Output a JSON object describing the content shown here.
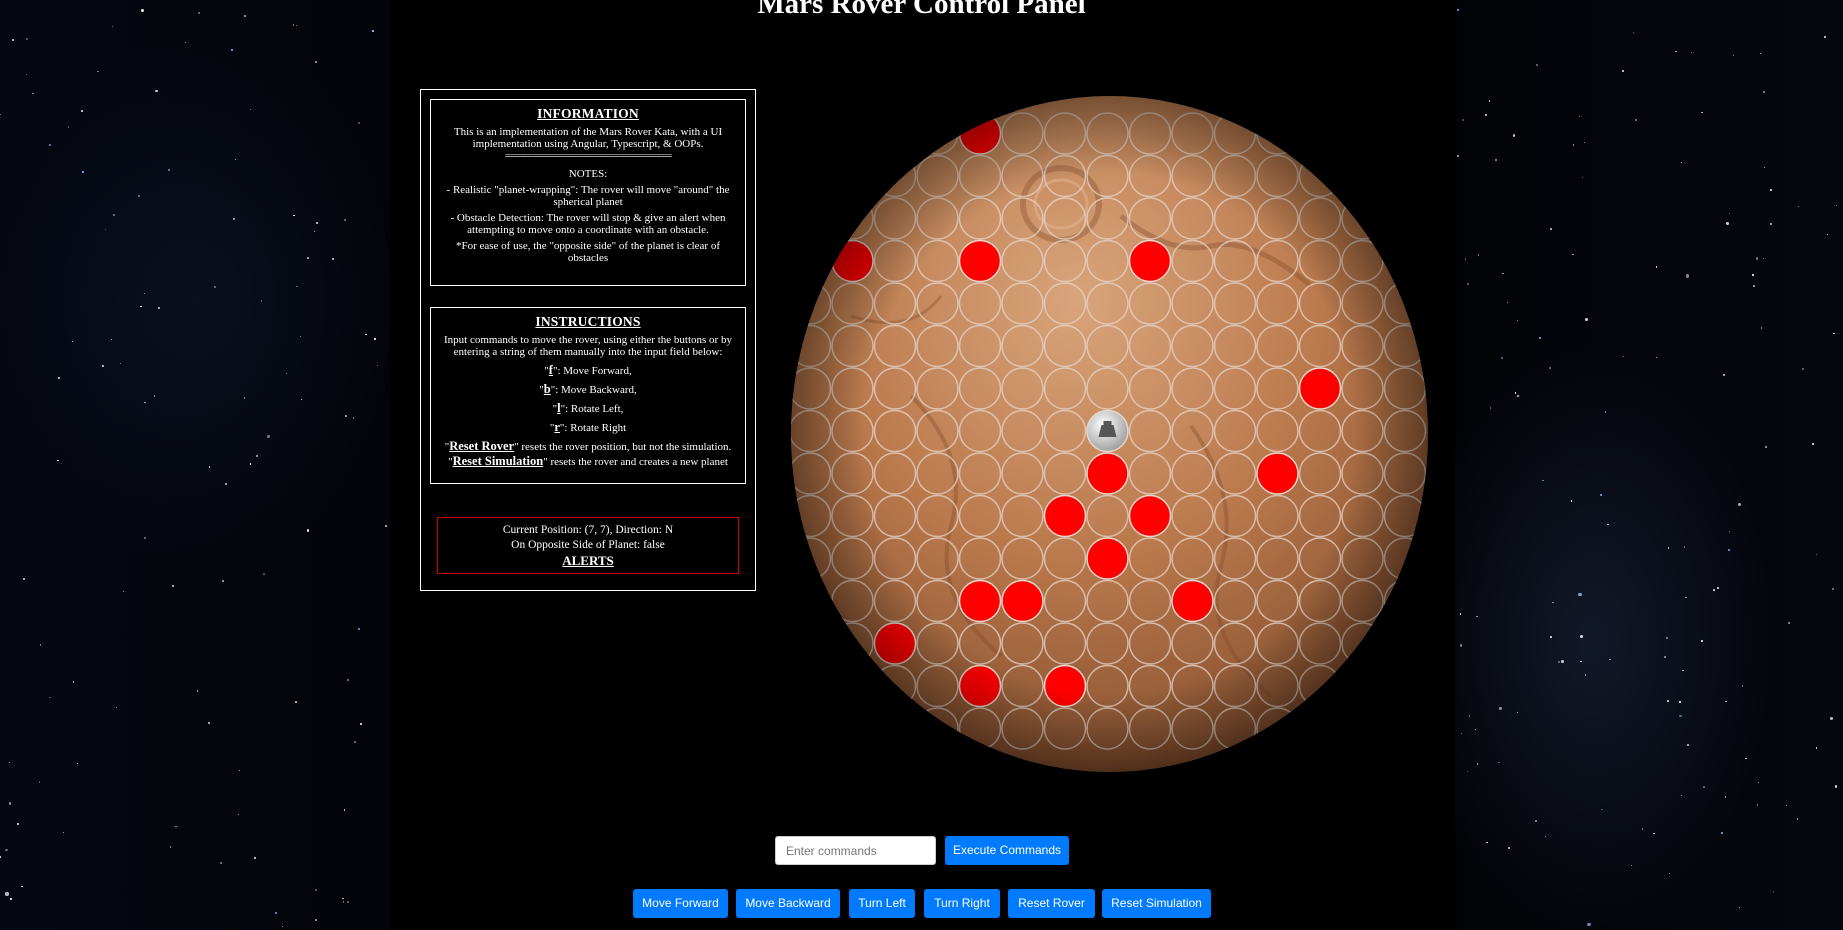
{
  "page": {
    "title": "Mars Rover Control Panel"
  },
  "information": {
    "heading": "INFORMATION",
    "description": "This is an implementation of the Mars Rover Kata, with a UI implementation using Angular, Typescript, & OOPs.",
    "divider": "================================",
    "notes_label": "NOTES:",
    "notes": [
      "- Realistic \"planet-wrapping\": The rover will move \"around\" the spherical planet",
      "- Obstacle Detection: The rover will stop & give an alert when attempting to move onto a coordinate with an obstacle.",
      "*For ease of use, the \"opposite side\" of the planet is clear of obstacles"
    ]
  },
  "instructions": {
    "heading": "INSTRUCTIONS",
    "intro": "Input commands to move the rover, using either the buttons or by entering a string of them manually into the input field below:",
    "commands": [
      {
        "key": "f",
        "desc": ": Move Forward,"
      },
      {
        "key": "b",
        "desc": ": Move Backward,"
      },
      {
        "key": "l",
        "desc": ": Rotate Left,"
      },
      {
        "key": "r",
        "desc": ": Rotate Right"
      }
    ],
    "reset_rover_name": "Reset Rover",
    "reset_rover_desc": "\" resets the rover position, but not the simulation.",
    "reset_sim_name": "Reset Simulation",
    "reset_sim_desc": "\" resets the rover and creates a new planet"
  },
  "status": {
    "position_line": "Current Position: (7, 7), Direction: N",
    "opposite_line": "On Opposite Side of Planet: false",
    "alerts_label": "ALERTS"
  },
  "grid": {
    "size": 15,
    "rover": {
      "col": 7,
      "row": 7
    },
    "obstacles": [
      [
        4,
        0
      ],
      [
        1,
        3
      ],
      [
        4,
        3
      ],
      [
        8,
        3
      ],
      [
        12,
        6
      ],
      [
        7,
        8
      ],
      [
        11,
        8
      ],
      [
        6,
        9
      ],
      [
        8,
        9
      ],
      [
        7,
        10
      ],
      [
        4,
        11
      ],
      [
        5,
        11
      ],
      [
        9,
        11
      ],
      [
        2,
        12
      ],
      [
        4,
        13
      ],
      [
        6,
        13
      ]
    ],
    "colors": {
      "obstacle": "#ff0000",
      "cell_border": "#e6d6cc",
      "rover": "#d8d8d8",
      "surface": "#b97547"
    }
  },
  "controls": {
    "input_placeholder": "Enter commands",
    "execute_label": "Execute Commands",
    "buttons": {
      "forward": "Move Forward",
      "backward": "Move Backward",
      "left": "Turn Left",
      "right": "Turn Right",
      "reset_rover": "Reset Rover",
      "reset_sim": "Reset Simulation"
    },
    "accent_color": "#007bff"
  }
}
